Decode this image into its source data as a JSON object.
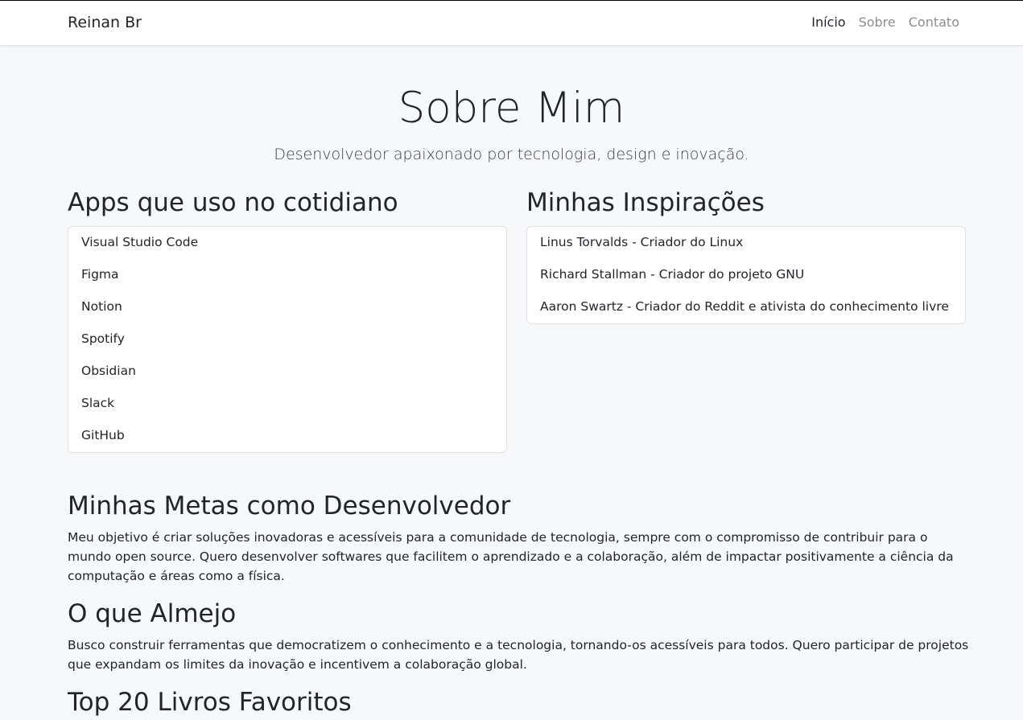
{
  "navbar": {
    "brand": "Reinan Br",
    "links": [
      "Início",
      "Sobre",
      "Contato"
    ]
  },
  "hero": {
    "title": "Sobre Mim",
    "subtitle": "Desenvolvedor apaixonado por tecnologia, design e inovação."
  },
  "apps": {
    "heading": "Apps que uso no cotidiano",
    "items": [
      "Visual Studio Code",
      "Figma",
      "Notion",
      "Spotify",
      "Obsidian",
      "Slack",
      "GitHub"
    ]
  },
  "inspirations": {
    "heading": "Minhas Inspirações",
    "items": [
      "Linus Torvalds - Criador do Linux",
      "Richard Stallman - Criador do projeto GNU",
      "Aaron Swartz - Criador do Reddit e ativista do conhecimento livre"
    ]
  },
  "goals": {
    "heading": "Minhas Metas como Desenvolvedor",
    "text": "Meu objetivo é criar soluções inovadoras e acessíveis para a comunidade de tecnologia, sempre com o compromisso de contribuir para o mundo open source. Quero desenvolver softwares que facilitem o aprendizado e a colaboração, além de impactar positivamente a ciência da computação e áreas como a física."
  },
  "aspire": {
    "heading": "O que Almejo",
    "text": "Busco construir ferramentas que democratizem o conhecimento e a tecnologia, tornando-os acessíveis para todos. Quero participar de projetos que expandam os limites da inovação e incentivem a colaboração global."
  },
  "books": {
    "heading": "Top 20 Livros Favoritos"
  }
}
